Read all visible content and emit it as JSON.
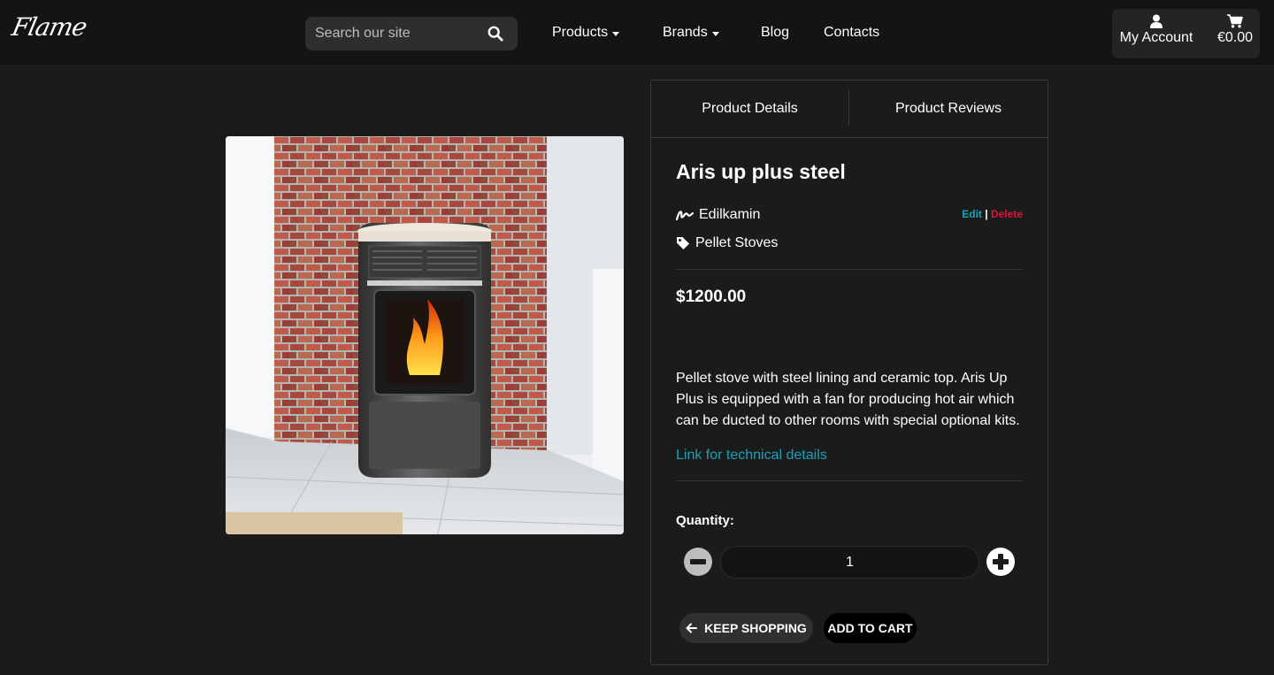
{
  "header": {
    "logo": "Flame",
    "search_placeholder": "Search our site",
    "nav": {
      "products": "Products",
      "brands": "Brands",
      "blog": "Blog",
      "contacts": "Contacts"
    },
    "account_label": "My Account",
    "cart_total": "€0.00"
  },
  "product": {
    "tabs": {
      "details": "Product Details",
      "reviews": "Product Reviews"
    },
    "name": "Aris up plus steel",
    "brand": "Edilkamin",
    "category": "Pellet Stoves",
    "admin": {
      "edit": "Edit",
      "separator": "|",
      "delete": "Delete"
    },
    "price": "$1200.00",
    "description": "Pellet stove with steel lining and ceramic top. Aris Up Plus is equipped with a fan for producing hot air which can be ducted to other rooms with special optional kits.",
    "tech_link": "Link for technical details",
    "quantity_label": "Quantity:",
    "quantity_value": "1",
    "keep_shopping": "Keep Shopping",
    "add_to_cart": "Add to Cart"
  },
  "colors": {
    "accent_link": "#17a2b8",
    "delete": "#dc143c",
    "background": "#1b1b1b",
    "navbar": "#141414"
  },
  "icons": [
    "search-icon",
    "user-icon",
    "cart-icon",
    "signature-icon",
    "tag-icon",
    "minus-circle-icon",
    "plus-circle-icon",
    "arrow-left-icon"
  ]
}
